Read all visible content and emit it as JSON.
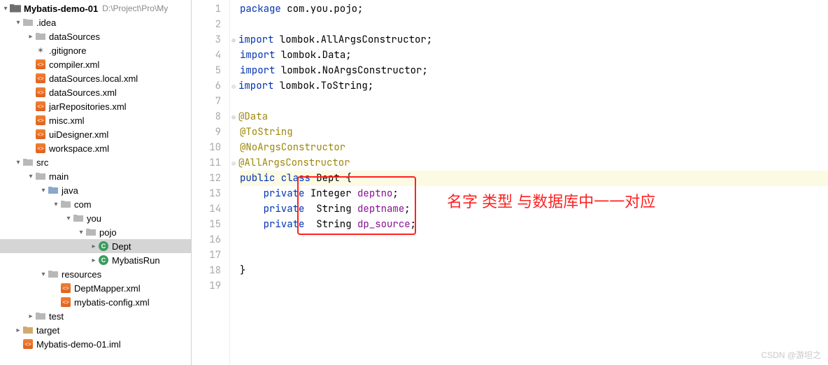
{
  "project": {
    "name": "Mybatis-demo-01",
    "path": "D:\\Project\\Pro\\My"
  },
  "tree": {
    "idea": ".idea",
    "dataSources": "dataSources",
    "gitignore": ".gitignore",
    "compiler": "compiler.xml",
    "dsLocal": "dataSources.local.xml",
    "dsXml": "dataSources.xml",
    "jarRepo": "jarRepositories.xml",
    "misc": "misc.xml",
    "uiDes": "uiDesigner.xml",
    "workspace": "workspace.xml",
    "src": "src",
    "main": "main",
    "java": "java",
    "com": "com",
    "you": "you",
    "pojo": "pojo",
    "dept": "Dept",
    "mybatisRun": "MybatisRun",
    "resources": "resources",
    "deptMapper": "DeptMapper.xml",
    "mybatisCfg": "mybatis-config.xml",
    "test": "test",
    "target": "target",
    "iml": "Mybatis-demo-01.iml"
  },
  "code": {
    "l1": {
      "p1": "package ",
      "p2": "com.you.pojo;"
    },
    "l3": {
      "p1": "import ",
      "p2": "lombok.",
      "p3": "AllArgsConstructor",
      ";": ";"
    },
    "l4": {
      "p1": "import ",
      "p2": "lombok.",
      "p3": "Data",
      ";": ";"
    },
    "l5": {
      "p1": "import ",
      "p2": "lombok.",
      "p3": "NoArgsConstructor",
      ";": ";"
    },
    "l6": {
      "p1": "import ",
      "p2": "lombok.",
      "p3": "ToString",
      ";": ";"
    },
    "l8": "@Data",
    "l9": "@ToString",
    "l10": "@NoArgsConstructor",
    "l11": "@AllArgsConstructor",
    "l12": {
      "p1": "public class ",
      "p2": "Dept ",
      "p3": "{"
    },
    "l13": {
      "p1": "    private ",
      "p2": "Integer ",
      "p3": "deptno",
      ";": ";"
    },
    "l14": {
      "p1": "    private  ",
      "p2": "String ",
      "p3": "deptname",
      ";": ";"
    },
    "l15": {
      "p1": "    private ",
      "p2": " String ",
      "p3": "dp_source",
      ";": ";"
    },
    "l18": "}"
  },
  "annotation": "名字 类型 与数据库中一一对应",
  "watermark": "CSDN @游坦之"
}
